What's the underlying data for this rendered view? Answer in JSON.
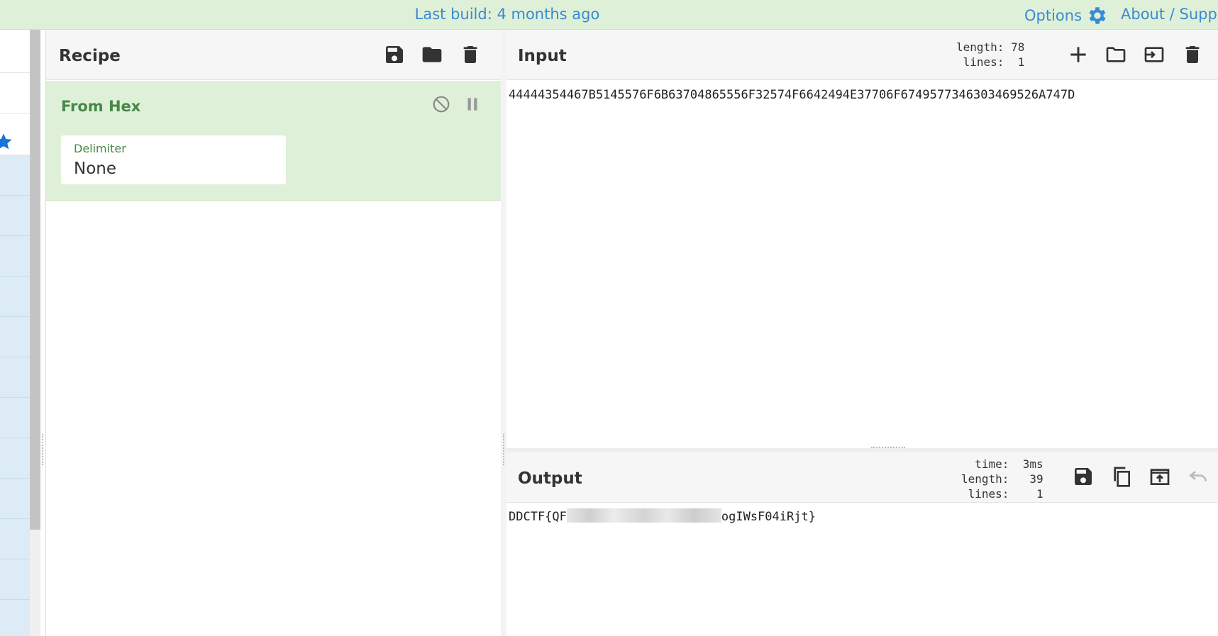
{
  "topbar": {
    "build_text": "Last build: 4 months ago",
    "options_label": "Options",
    "about_label": "About / Suppo"
  },
  "recipe": {
    "title": "Recipe",
    "operation": {
      "name": "From Hex",
      "arg_label": "Delimiter",
      "arg_value": "None"
    }
  },
  "input": {
    "title": "Input",
    "stats": "length: 78\n lines:  1",
    "value": "44444354467B5145576F6B63704865556F32574F6642494E37706F6749577346303469526A747D"
  },
  "output": {
    "title": "Output",
    "stats": "  time:  3ms\nlength:   39\n lines:    1",
    "value_prefix": "DDCTF{QF",
    "value_suffix": "ogIWsF04iRjt}"
  },
  "colors": {
    "accent_blue": "#3a8ad2",
    "op_green_bg": "#dff0d8",
    "op_green_text": "#468847"
  },
  "icons": [
    "gear-icon",
    "star-icon",
    "save-icon",
    "folder-icon",
    "trash-icon",
    "disable-icon",
    "pause-icon",
    "plus-icon",
    "open-folder-icon",
    "input-switch-icon",
    "copy-icon",
    "replace-input-icon",
    "undo-icon"
  ]
}
